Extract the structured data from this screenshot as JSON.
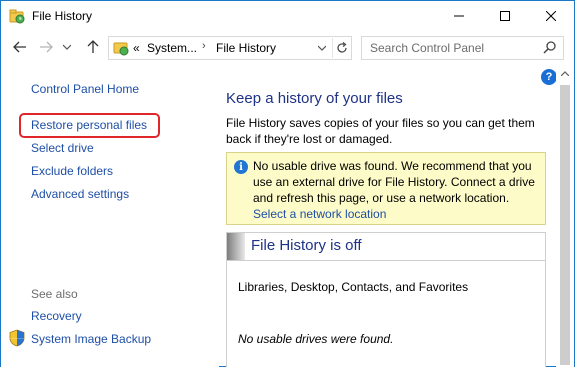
{
  "window": {
    "title": "File History",
    "icon": "file-history-icon"
  },
  "titlebar_buttons": {
    "minimize": "minimize-icon",
    "maximize": "maximize-icon",
    "close": "close-icon"
  },
  "navigation": {
    "back": "back-arrow-icon",
    "forward": "forward-arrow-icon",
    "recent": "chevron-down-icon",
    "up": "up-arrow-icon"
  },
  "address": {
    "overflow": "«",
    "part1": "System...",
    "separator": "›",
    "part2": "File History"
  },
  "search": {
    "placeholder": "Search Control Panel"
  },
  "sidebar": {
    "control_panel_home": "Control Panel Home",
    "items": [
      {
        "label": "Restore personal files"
      },
      {
        "label": "Select drive"
      },
      {
        "label": "Exclude folders"
      },
      {
        "label": "Advanced settings"
      }
    ],
    "see_also": "See also",
    "see_also_items": [
      {
        "label": "Recovery"
      },
      {
        "label": "System Image Backup"
      }
    ]
  },
  "main": {
    "help": "?",
    "heading": "Keep a history of your files",
    "description": "File History saves copies of your files so you can get them back if they're lost or damaged.",
    "info": {
      "icon_glyph": "i",
      "message": "No usable drive was found. We recommend that you use an external drive for File History. Connect a drive and refresh this page, or use a network location.",
      "link": "Select a network location"
    },
    "status": {
      "title": "File History is off",
      "libraries": "Libraries, Desktop, Contacts, and Favorites",
      "no_drives": "No usable drives were found."
    }
  },
  "colors": {
    "link": "#1e4fa6",
    "heading": "#1e3287",
    "info_bg": "#fdfbc7",
    "highlight": "#e0252b",
    "window_border": "#1b78c6"
  }
}
